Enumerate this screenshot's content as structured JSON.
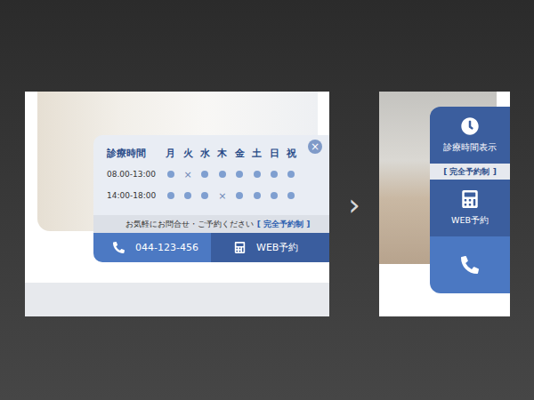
{
  "schedule_panel": {
    "close": "×",
    "header": [
      "診療時間",
      "月",
      "火",
      "水",
      "木",
      "金",
      "土",
      "日",
      "祝"
    ],
    "rows": [
      {
        "time": "08.00-13:00",
        "days": [
          {
            "open": true
          },
          {
            "open": false,
            "mark": "×"
          },
          {
            "open": true
          },
          {
            "open": true
          },
          {
            "open": true
          },
          {
            "open": true
          },
          {
            "open": true
          },
          {
            "open": true
          }
        ]
      },
      {
        "time": "14:00-18:00",
        "days": [
          {
            "open": true
          },
          {
            "open": true
          },
          {
            "open": true
          },
          {
            "open": false,
            "mark": "×"
          },
          {
            "open": true
          },
          {
            "open": true
          },
          {
            "open": true
          },
          {
            "open": true
          }
        ]
      }
    ],
    "notice": {
      "text": "お気軽にお問合せ・ご予約ください",
      "badge": "[ 完全予約制 ]"
    },
    "buttons": [
      {
        "kind": "phone",
        "label": "044-123-456"
      },
      {
        "kind": "web",
        "label": "WEB予約"
      }
    ]
  },
  "arrow": "›",
  "side_tab": {
    "items": [
      {
        "kind": "hours",
        "label": "診療時間表示"
      },
      {
        "kind": "notice",
        "label": "[ 完全予約制 ]"
      },
      {
        "kind": "web",
        "label": "WEB予約"
      },
      {
        "kind": "phone"
      }
    ]
  }
}
